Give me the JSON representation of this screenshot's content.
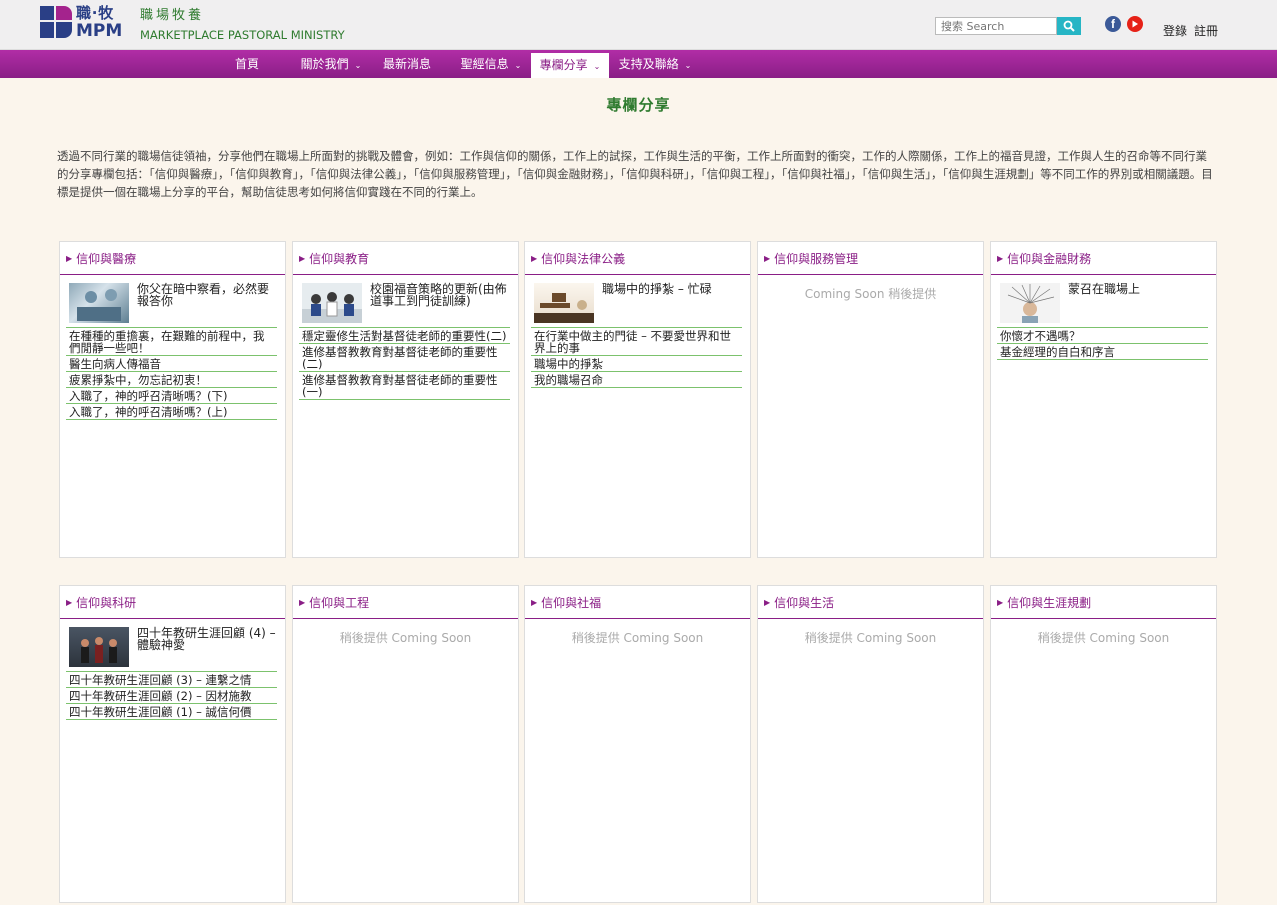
{
  "header": {
    "logo_cn": "職‧牧",
    "logo_en": "MPM",
    "brand_cn": "職場牧養",
    "brand_en": "MARKETPLACE PASTORAL MINISTRY",
    "search_placeholder": "搜索 Search",
    "login": "登錄",
    "register": "註冊",
    "colors": {
      "brand_purple": "#a4238d",
      "brand_blue": "#2a3f86",
      "green": "#2f7b2f",
      "search_btn": "#26b5c5"
    }
  },
  "nav": {
    "items": [
      {
        "label": "首頁"
      },
      {
        "label": "關於我們",
        "caret": "⌄"
      },
      {
        "label": "最新消息"
      },
      {
        "label": "聖經信息",
        "caret": "⌄"
      },
      {
        "label": "專欄分享",
        "caret": "⌄",
        "active": true
      },
      {
        "label": "支持及聯絡",
        "caret": "⌄"
      }
    ]
  },
  "page": {
    "title": "專欄分享",
    "intro": "透過不同行業的職場信徒領袖，分享他們在職場上所面對的挑戰及體會，例如：工作與信仰的關係，工作上的試探，工作與生活的平衡，工作上所面對的衝突，工作的人際關係，工作上的福音見證，工作與人生的召命等不同行業的分享專欄包括：「信仰與醫療」，「信仰與教育」，「信仰與法律公義」，「信仰與服務管理」，「信仰與金融財務」，「信仰與科研」，「信仰與工程」，「信仰與社福」，「信仰與生活」，「信仰與生涯規劃」等不同工作的界別或相關議題。目標是提供一個在職場上分享的平台，幫助信徒思考如何將信仰實踐在不同的行業上。"
  },
  "cards": [
    {
      "title": "信仰與醫療",
      "feature": "你父在暗中察看，必然要報答你",
      "links": [
        "在種種的重擔裏，在艱難的前程中，我們閒靜一些吧！",
        "醫生向病人傳福音",
        "疲累掙紮中，勿忘記初衷！",
        "入職了，神的呼召清晰嗎？(下)",
        "入職了，神的呼召清晰嗎？(上)"
      ]
    },
    {
      "title": "信仰與教育",
      "feature": "校園福音策略的更新(由佈道事工到門徒訓練)",
      "links": [
        "穩定靈修生活對基督徒老師的重要性(二)",
        "進修基督教教育對基督徒老師的重要性(二)",
        "進修基督教教育對基督徒老師的重要性(一)"
      ]
    },
    {
      "title": "信仰與法律公義",
      "feature": "職場中的掙紮 – 忙碌",
      "links": [
        "在行業中做主的門徒 – 不要愛世界和世界上的事",
        "職場中的掙紮",
        "我的職場召命"
      ]
    },
    {
      "title": "信仰與服務管理",
      "soon": "Coming Soon 稍後提供"
    },
    {
      "title": "信仰與金融財務",
      "feature": "蒙召在職場上",
      "links": [
        "你懷才不遇嗎？",
        "基金經理的自白和序言"
      ]
    },
    {
      "title": "信仰與科研",
      "feature": "四十年教研生涯回顧 (4) – 體驗神愛",
      "links": [
        "四十年教研生涯回顧 (3) – 連繫之情",
        "四十年教研生涯回顧 (2) – 因材施教",
        "四十年教研生涯回顧 (1) – 誠信何價"
      ]
    },
    {
      "title": "信仰與工程",
      "soon": "稍後提供 Coming Soon"
    },
    {
      "title": "信仰與社福",
      "soon": "稍後提供 Coming Soon"
    },
    {
      "title": "信仰與生活",
      "soon": "稍後提供 Coming Soon"
    },
    {
      "title": "信仰與生涯規劃",
      "soon": "稍後提供 Coming Soon"
    }
  ]
}
